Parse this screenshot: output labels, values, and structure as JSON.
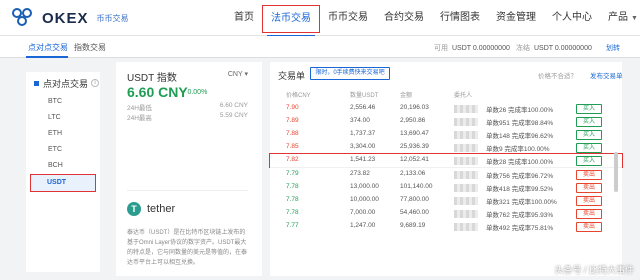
{
  "brand": {
    "name": "OKEX",
    "subtitle": "币币交易"
  },
  "nav": {
    "items": [
      {
        "label": "首页",
        "active": false
      },
      {
        "label": "法币交易",
        "active": true
      },
      {
        "label": "币币交易",
        "active": false
      },
      {
        "label": "合约交易",
        "active": false
      },
      {
        "label": "行情图表",
        "active": false
      },
      {
        "label": "资金管理",
        "active": false
      },
      {
        "label": "个人中心",
        "active": false
      },
      {
        "label": "产品",
        "active": false,
        "dropdown": true
      }
    ]
  },
  "subbar": {
    "tabs": [
      "点对点交易",
      "指数交易"
    ],
    "available_label": "可用",
    "available_value": "USDT 0.00000000",
    "frozen_label": "冻结",
    "frozen_value": "USDT 0.00000000",
    "transfer": "划转"
  },
  "sidebar": {
    "title": "点对点交易",
    "info": "i",
    "items": [
      "BTC",
      "LTC",
      "ETH",
      "ETC",
      "BCH",
      "USDT"
    ],
    "active": "USDT"
  },
  "info_panel": {
    "title": "USDT 指数",
    "currency": "CNY",
    "price": "6.60 CNY",
    "change": "0.00%",
    "high_label": "24H最低",
    "high_value": "6.60 CNY",
    "low_label": "24H最高",
    "low_value": "5.59 CNY",
    "coin_name": "tether",
    "description": "泰达币（USDT）是在比特币区块链上发布的基于Omni Layer协议的数字资产。USDT最大的特点是，它与同数量的美元是等值的，在泰达币平台上可以相互兑换。"
  },
  "orders": {
    "title": "交易单",
    "filter": "限时，0手续费快来交易吧",
    "unsuitable": "价格不合适？",
    "publish": "发布交易单",
    "headers": {
      "price": "价格CNY",
      "amount": "数量USDT",
      "total": "金额",
      "user": "委托人"
    },
    "rows": [
      {
        "price": "7.90",
        "side": "sell",
        "amount": "2,556.46",
        "total": "20,196.03",
        "stats": "单数26  完成率100.00%",
        "action": "买入"
      },
      {
        "price": "7.89",
        "side": "sell",
        "amount": "374.00",
        "total": "2,950.86",
        "stats": "单数951  完成率98.84%",
        "action": "买入"
      },
      {
        "price": "7.88",
        "side": "sell",
        "amount": "1,737.37",
        "total": "13,690.47",
        "stats": "单数148  完成率96.62%",
        "action": "买入"
      },
      {
        "price": "7.85",
        "side": "sell",
        "amount": "3,304.00",
        "total": "25,936.39",
        "stats": "单数9  完成率100.00%",
        "action": "买入"
      },
      {
        "price": "7.82",
        "side": "sell",
        "amount": "1,541.23",
        "total": "12,052.41",
        "stats": "单数28  完成率100.00%",
        "action": "买入",
        "highlight": true
      },
      {
        "price": "7.79",
        "side": "buy",
        "amount": "273.82",
        "total": "2,133.06",
        "stats": "单数756  完成率96.72%",
        "action": "卖出"
      },
      {
        "price": "7.78",
        "side": "buy",
        "amount": "13,000.00",
        "total": "101,140.00",
        "stats": "单数418  完成率99.52%",
        "action": "卖出"
      },
      {
        "price": "7.78",
        "side": "buy",
        "amount": "10,000.00",
        "total": "77,800.00",
        "stats": "单数321  完成率100.00%",
        "action": "卖出"
      },
      {
        "price": "7.78",
        "side": "buy",
        "amount": "7,000.00",
        "total": "54,460.00",
        "stats": "单数762  完成率95.93%",
        "action": "卖出"
      },
      {
        "price": "7.77",
        "side": "buy",
        "amount": "1,247.00",
        "total": "9,689.19",
        "stats": "单数492  完成率75.81%",
        "action": "卖出"
      }
    ]
  },
  "watermark": "头条号 / 比特大事件",
  "colors": {
    "accent": "#1a66d6",
    "sell": "#e8452f",
    "buy": "#1f9d55",
    "highlight": "#e03333"
  }
}
